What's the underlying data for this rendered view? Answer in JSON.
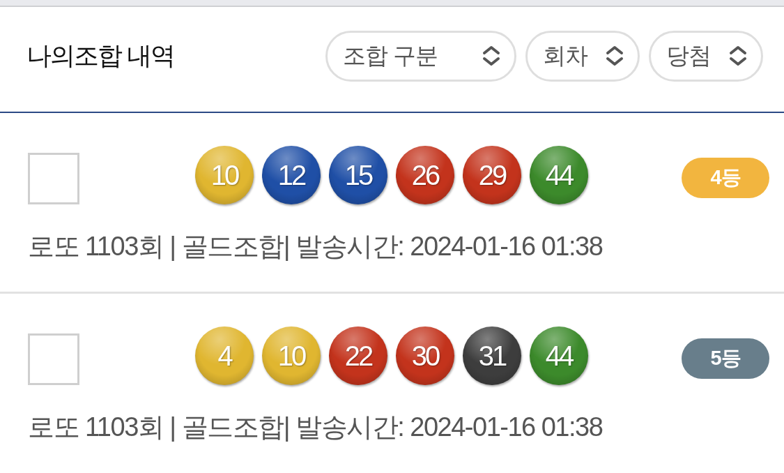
{
  "header": {
    "title": "나의조합 내역",
    "filters": [
      {
        "label": "조합 구분"
      },
      {
        "label": "회차"
      },
      {
        "label": "당첨"
      }
    ]
  },
  "combinations": [
    {
      "checked": false,
      "balls": [
        {
          "number": "10",
          "color": "#e0b630"
        },
        {
          "number": "12",
          "color": "#1f4fa6"
        },
        {
          "number": "15",
          "color": "#1f4fa6"
        },
        {
          "number": "26",
          "color": "#c3331c"
        },
        {
          "number": "29",
          "color": "#c3331c"
        },
        {
          "number": "44",
          "color": "#3c8a2b"
        }
      ],
      "rank": {
        "label": "4등",
        "color": "#f2b53f"
      },
      "info": "로또 1103회 | 골드조합| 발송시간: 2024-01-16 01:38"
    },
    {
      "checked": false,
      "balls": [
        {
          "number": "4",
          "color": "#e0b630"
        },
        {
          "number": "10",
          "color": "#e0b630"
        },
        {
          "number": "22",
          "color": "#c3331c"
        },
        {
          "number": "30",
          "color": "#c3331c"
        },
        {
          "number": "31",
          "color": "#3d3d3d"
        },
        {
          "number": "44",
          "color": "#3c8a2b"
        }
      ],
      "rank": {
        "label": "5등",
        "color": "#687e8b"
      },
      "info": "로또 1103회 | 골드조합| 발송시간: 2024-01-16 01:38"
    }
  ]
}
